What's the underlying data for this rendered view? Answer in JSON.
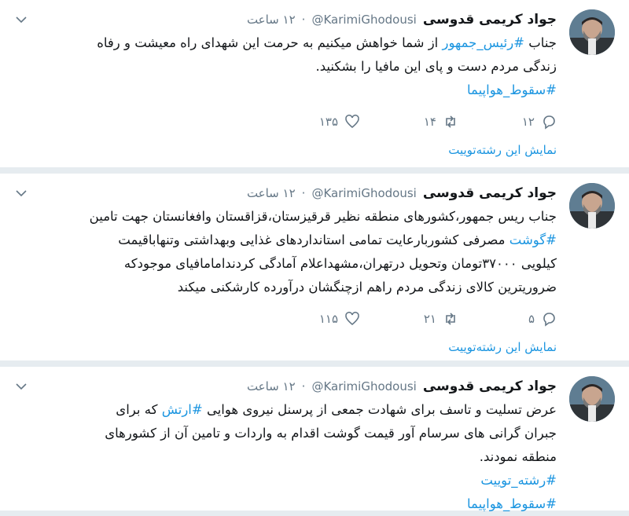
{
  "tweets": [
    {
      "name": "جواد کریمی قدوسی",
      "handle": "@KarimiGhodousi",
      "dot": "·",
      "time": "۱۲ ساعت",
      "body": [
        [
          {
            "text": "جناب "
          },
          {
            "text": "#رئیس_جمهور",
            "tag": true
          },
          {
            "text": " از شما خواهش میکنیم به حرمت این شهدای راه معیشت و رفاه"
          }
        ],
        [
          {
            "text": "زندگی مردم دست و پای این مافیا را بشکنید."
          }
        ],
        [
          {
            "text": "#سقوط_هواپیما",
            "tag": true
          }
        ]
      ],
      "replies": "۱۲",
      "retweets": "۱۴",
      "likes": "۱۳۵",
      "thread": "نمایش این رشته‌توییت"
    },
    {
      "name": "جواد کریمی قدوسی",
      "handle": "@KarimiGhodousi",
      "dot": "·",
      "time": "۱۲ ساعت",
      "body": [
        [
          {
            "text": "جناب ریس جمهور،کشورهای منطقه نظیر قرقیزستان،قزاقستان وافغانستان جهت تامین"
          }
        ],
        [
          {
            "text": "#گوشت",
            "tag": true
          },
          {
            "text": " مصرفی کشوربارعایت تمامی استانداردهای غذایی وبهداشتی وتنهاباقیمت"
          }
        ],
        [
          {
            "text": "کیلویی ۳۷۰۰۰تومان وتحویل درتهران،مشهداعلام آمادگی کردندامامافیای موجودکه"
          }
        ],
        [
          {
            "text": "ضروریترین کالای زندگی مردم راهم ازچنگشان درآورده کارشکنی میکند"
          }
        ]
      ],
      "replies": "۵",
      "retweets": "۲۱",
      "likes": "۱۱۵",
      "thread": "نمایش این رشته‌توییت"
    },
    {
      "name": "جواد کریمی قدوسی",
      "handle": "@KarimiGhodousi",
      "dot": "·",
      "time": "۱۲ ساعت",
      "body": [
        [
          {
            "text": "عرض تسلیت و تاسف برای شهادت جمعی از پرسنل نیروی هوایی "
          },
          {
            "text": "#ارتش",
            "tag": true
          },
          {
            "text": " که برای"
          }
        ],
        [
          {
            "text": "جبران گرانی های سرسام آور قیمت گوشت اقدام به واردات و تامین آن از کشورهای"
          }
        ],
        [
          {
            "text": "منطقه نمودند."
          }
        ],
        [
          {
            "text": "#رشته_توییت",
            "tag": true
          }
        ],
        [
          {
            "text": "#سقوط_هواپیما",
            "tag": true
          }
        ]
      ]
    }
  ],
  "colors": {
    "accent": "#1b95e0",
    "muted": "#657786",
    "background": "#e6ecf0"
  },
  "icons": {
    "reply": "reply-icon",
    "retweet": "retweet-icon",
    "like": "heart-icon",
    "menu": "chevron-down-icon"
  }
}
